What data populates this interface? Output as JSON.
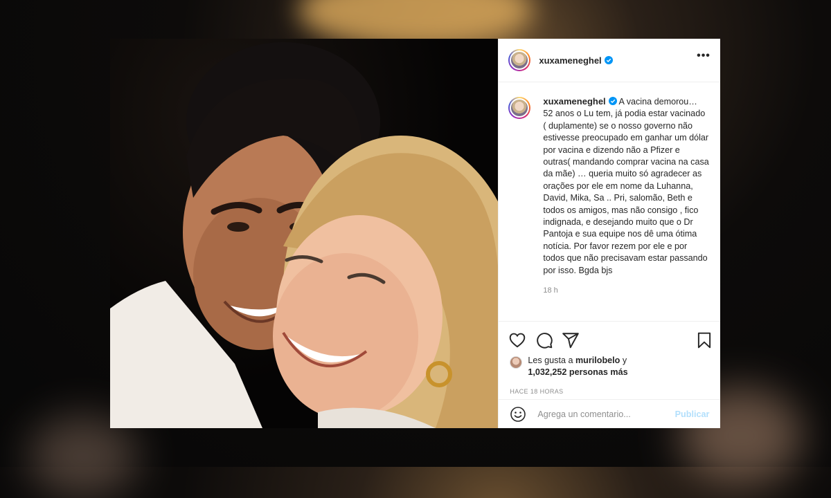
{
  "post": {
    "username": "xuxameneghel",
    "verified": true,
    "caption": "A vacina demorou… 52 anos o Lu tem, já podia estar vacinado ( duplamente) se o nosso governo não estivesse preocupado em ganhar um dólar por vacina e dizendo não a Pfizer e outras( mandando comprar vacina na casa da mãe) … queria muito só agradecer as orações por ele em nome da Luhanna, David, Mika, Sa .. Pri, salomão, Beth e todos os amigos, mas não consigo , fico indignada, e desejando muito que o Dr Pantoja e sua equipe nos dê uma ótima notícia. Por favor rezem por ele e por todos que não precisavam estar passando por isso. Bgda bjs",
    "caption_time": "18 h",
    "likes_prefix": "Les gusta a ",
    "likes_user": "murilobelo",
    "likes_conj": " y",
    "likes_count": "1,032,252 personas más",
    "posted_ago": "HACE 18 HORAS",
    "comment_placeholder": "Agrega un comentario...",
    "publish_label": "Publicar"
  },
  "icons": {
    "more": "more-options-icon",
    "like": "heart-icon",
    "comment": "comment-icon",
    "share": "share-icon",
    "save": "bookmark-icon",
    "emoji": "emoji-icon",
    "verified": "verified-badge-icon"
  },
  "colors": {
    "verified_blue": "#0095f6",
    "publish_disabled": "#b2dffc",
    "text": "#262626",
    "muted": "#8e8e8e"
  }
}
